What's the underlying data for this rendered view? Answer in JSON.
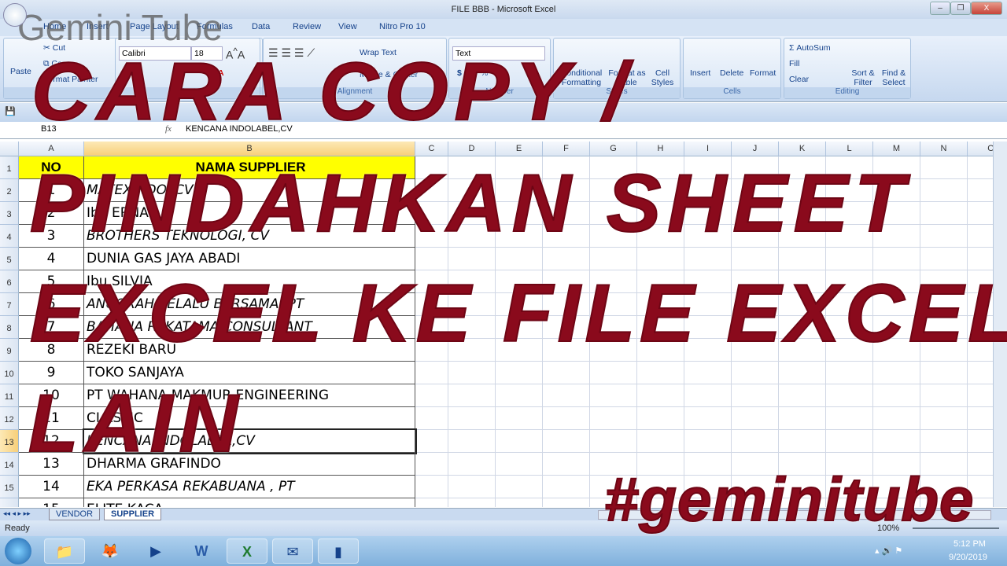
{
  "window": {
    "title": "FILE BBB - Microsoft Excel",
    "min": "–",
    "restore": "❐",
    "close": "X"
  },
  "watermark": "Gemini Tube",
  "tabs": [
    "Home",
    "Insert",
    "Page Layout",
    "Formulas",
    "Data",
    "Review",
    "View",
    "Nitro Pro 10"
  ],
  "ribbon": {
    "clipboard": {
      "label": "Clipboard",
      "paste": "Paste",
      "cut": "Cut",
      "copy": "Copy",
      "painter": "Format Painter"
    },
    "font": {
      "label": "Font",
      "name": "Calibri",
      "size": "18"
    },
    "alignment": {
      "label": "Alignment",
      "wrap": "Wrap Text",
      "merge": "Merge & Center"
    },
    "number": {
      "label": "Number",
      "format": "Text",
      "currency": "$",
      "percent": "%",
      "comma": ","
    },
    "styles": {
      "label": "Styles",
      "cond": "Conditional Formatting",
      "table": "Format as Table",
      "cell": "Cell Styles"
    },
    "cells": {
      "label": "Cells",
      "insert": "Insert",
      "delete": "Delete",
      "format": "Format"
    },
    "editing": {
      "label": "Editing",
      "autosum": "AutoSum",
      "fill": "Fill",
      "clear": "Clear",
      "sort": "Sort & Filter",
      "find": "Find & Select"
    }
  },
  "formula_bar": {
    "name_box": "B13",
    "fx": "fx",
    "value": "KENCANA INDOLABEL,CV"
  },
  "columns": [
    "A",
    "B",
    "C",
    "D",
    "E",
    "F",
    "G",
    "H",
    "I",
    "J",
    "K",
    "L",
    "M",
    "N",
    "O"
  ],
  "header_row": {
    "no": "NO",
    "name": "NAMA SUPPLIER",
    "color": "#ffff00"
  },
  "rows": [
    {
      "no": "1",
      "name": "MATEXINDO, CV",
      "italic": true
    },
    {
      "no": "2",
      "name": "Ibu ERNA",
      "italic": false
    },
    {
      "no": "3",
      "name": "BROTHERS TEKNOLOGI, CV",
      "italic": true
    },
    {
      "no": "4",
      "name": "DUNIA GAS JAYA ABADI",
      "italic": false
    },
    {
      "no": "5",
      "name": "Ibu SILVIA",
      "italic": false
    },
    {
      "no": "6",
      "name": "ANUGRAH SELALU BERSAMA, PT",
      "italic": true
    },
    {
      "no": "7",
      "name": "BAHANA REKATAMA CONSULTANT",
      "italic": true
    },
    {
      "no": "8",
      "name": "REZEKI BARU",
      "italic": false
    },
    {
      "no": "9",
      "name": "TOKO SANJAYA",
      "italic": false
    },
    {
      "no": "10",
      "name": "PT WAHANA MAKMUR ENGINEERING",
      "italic": false
    },
    {
      "no": "11",
      "name": "CLASSIC",
      "italic": false
    },
    {
      "no": "12",
      "name": "KENCANA INDOLABEL,CV",
      "italic": true
    },
    {
      "no": "13",
      "name": "DHARMA GRAFINDO",
      "italic": false
    },
    {
      "no": "14",
      "name": "EKA PERKASA REKABUANA , PT",
      "italic": true
    },
    {
      "no": "15",
      "name": "ELITE KACA",
      "italic": false
    }
  ],
  "selected_row": "13",
  "sheet_tabs": [
    "VENDOR",
    "SUPPLIER"
  ],
  "active_sheet": "SUPPLIER",
  "status": {
    "text": "Ready",
    "zoom": "100%"
  },
  "taskbar": {
    "time": "5:12 PM",
    "date": "9/20/2019",
    "icons": [
      "windows-start-icon",
      "file-explorer-icon",
      "firefox-icon",
      "media-player-icon",
      "word-icon",
      "excel-icon",
      "outlook-icon",
      "video-app-icon"
    ]
  },
  "overlay": {
    "line1": "CARA COPY /",
    "line2": "PINDAHKAN SHEET",
    "line3": "EXCEL KE FILE EXCEL",
    "line4": "LAIN",
    "hashtag": "#geminitube",
    "color": "#8a0a1c"
  }
}
